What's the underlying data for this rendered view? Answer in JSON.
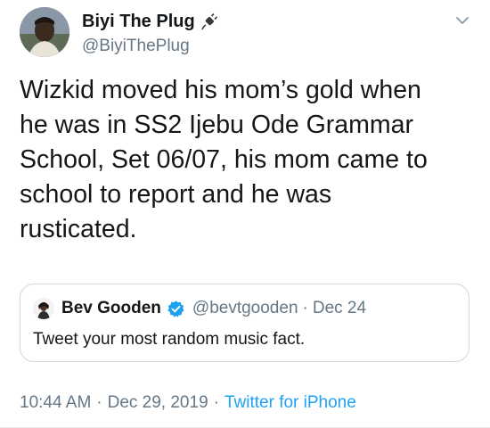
{
  "author": {
    "display_name": "Biyi The Plug",
    "handle": "@BiyiThePlug",
    "name_emoji_icon": "electric-plug-icon"
  },
  "tweet": {
    "text": "Wizkid moved his mom’s gold when\nhe was in SS2 Ijebu Ode Grammar\nSchool, Set 06/07, his mom came to\nschool to report and he was\nrusticated."
  },
  "quoted_tweet": {
    "display_name": "Bev Gooden",
    "verified": true,
    "handle": "@bevtgooden",
    "separator": "·",
    "date": "Dec 24",
    "text": "Tweet your most random music fact."
  },
  "meta": {
    "time": "10:44 AM",
    "separator": "·",
    "date": "Dec 29, 2019",
    "source": "Twitter for iPhone"
  },
  "colors": {
    "text": "#14171a",
    "secondary": "#657786",
    "link": "#1da1f2",
    "border": "#ccd6dd"
  }
}
